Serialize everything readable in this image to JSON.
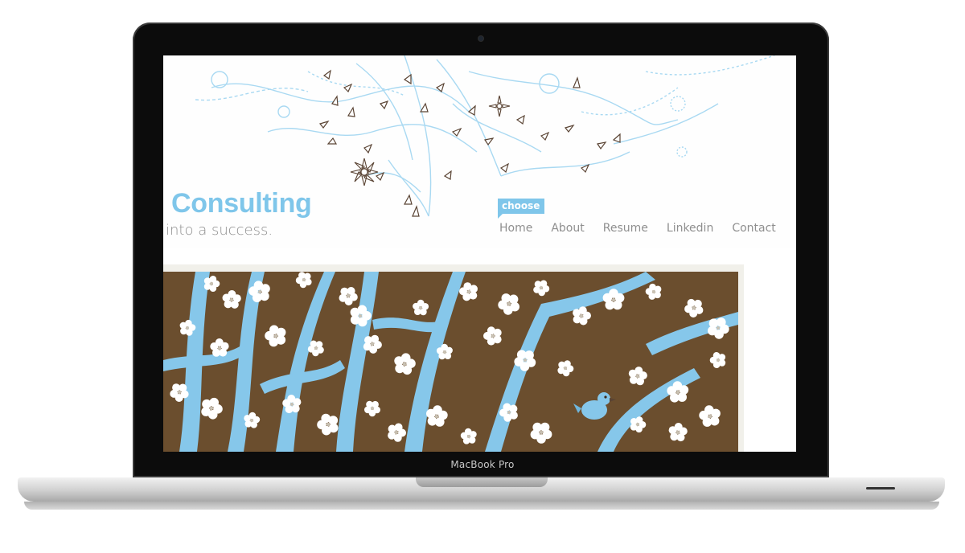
{
  "device": {
    "model_label": "MacBook Pro"
  },
  "site": {
    "brand_title": "Consulting",
    "tagline": "into a success.",
    "choose_badge": "choose",
    "nav": [
      {
        "label": "Home"
      },
      {
        "label": "About"
      },
      {
        "label": "Resume"
      },
      {
        "label": "Linkedin"
      },
      {
        "label": "Contact"
      }
    ]
  },
  "colors": {
    "accent": "#7fc6ea",
    "text_gray": "#8f8f8f",
    "banner_brown": "#6b4e2e",
    "flower_white": "#ffffff"
  },
  "icons": {
    "header_art": "floral-ornament-icon",
    "banner_art": "cherry-blossom-tree-illustration",
    "bird": "bird-icon"
  }
}
